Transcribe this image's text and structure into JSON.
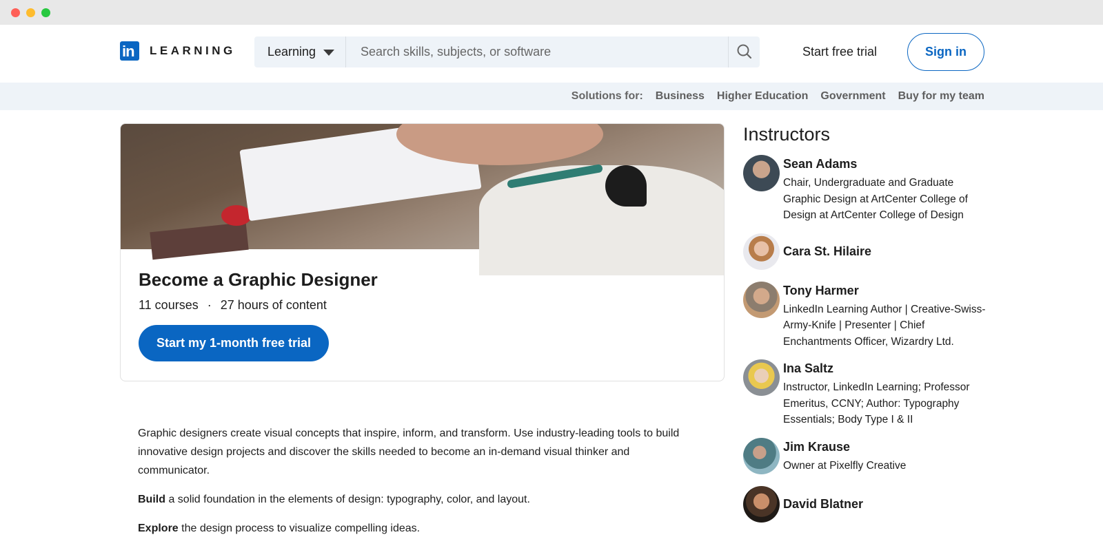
{
  "brand": {
    "logo_mark": "in",
    "logo_text": "LEARNING",
    "accent": "#0a66c2"
  },
  "search": {
    "category": "Learning",
    "placeholder": "Search skills, subjects, or software",
    "value": ""
  },
  "nav": {
    "free_trial": "Start free trial",
    "sign_in": "Sign in"
  },
  "subnav": {
    "label": "Solutions for:",
    "items": [
      "Business",
      "Higher Education",
      "Government",
      "Buy for my team"
    ]
  },
  "path": {
    "title": "Become a Graphic Designer",
    "courses": "11 courses",
    "separator": "·",
    "hours": "27 hours of content",
    "cta": "Start my 1-month free trial"
  },
  "description": {
    "intro": "Graphic designers create visual concepts that inspire, inform, and transform. Use industry-leading tools to build innovative design projects and discover the skills needed to become an in-demand visual thinker and communicator.",
    "build_bold": "Build",
    "build_rest": " a solid foundation in the elements of design: typography, color, and layout.",
    "explore_bold": "Explore",
    "explore_rest": " the design process to visualize compelling ideas."
  },
  "instructors": {
    "heading": "Instructors",
    "items": [
      {
        "name": "Sean Adams",
        "role": "Chair, Undergraduate and Graduate Graphic Design at ArtCenter College of Design at ArtCenter College of Design"
      },
      {
        "name": "Cara St. Hilaire",
        "role": ""
      },
      {
        "name": "Tony Harmer",
        "role": "LinkedIn Learning Author | Creative-Swiss-Army-Knife | Presenter | Chief Enchantments Officer, Wizardry Ltd."
      },
      {
        "name": "Ina Saltz",
        "role": "Instructor, LinkedIn Learning; Professor Emeritus, CCNY; Author: Typography Essentials; Body Type I & II"
      },
      {
        "name": "Jim Krause",
        "role": "Owner at Pixelfly Creative"
      },
      {
        "name": "David Blatner",
        "role": ""
      }
    ]
  }
}
